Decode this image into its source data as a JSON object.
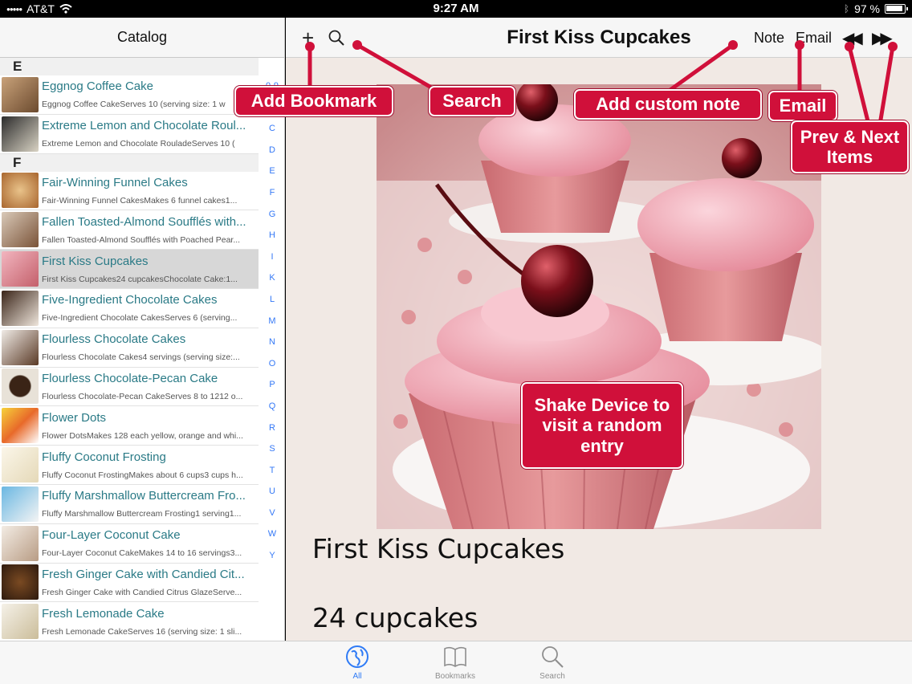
{
  "status": {
    "carrier": "AT&T",
    "time": "9:27 AM",
    "battery": "97 %"
  },
  "sidebar": {
    "title": "Catalog",
    "sections": [
      {
        "letter": "E",
        "items": [
          {
            "title": "Eggnog Coffee Cake",
            "subtitle": "Eggnog Coffee CakeServes 10 (serving size: 1 w"
          },
          {
            "title": "Extreme Lemon and Chocolate Roul...",
            "subtitle": "Extreme Lemon and Chocolate RouladeServes 10 ("
          }
        ]
      },
      {
        "letter": "F",
        "items": [
          {
            "title": "Fair-Winning Funnel Cakes",
            "subtitle": "Fair-Winning Funnel CakesMakes 6 funnel cakes1..."
          },
          {
            "title": "Fallen Toasted-Almond Soufflés with...",
            "subtitle": "Fallen Toasted-Almond Soufflés with Poached Pear..."
          },
          {
            "title": "First Kiss Cupcakes",
            "subtitle": "First Kiss Cupcakes24 cupcakesChocolate Cake:1..."
          },
          {
            "title": "Five-Ingredient Chocolate Cakes",
            "subtitle": "Five-Ingredient Chocolate CakesServes 6 (serving..."
          },
          {
            "title": "Flourless Chocolate Cakes",
            "subtitle": "Flourless Chocolate Cakes4 servings (serving size:..."
          },
          {
            "title": "Flourless Chocolate-Pecan Cake",
            "subtitle": "Flourless Chocolate-Pecan CakeServes 8 to 1212 o..."
          },
          {
            "title": "Flower Dots",
            "subtitle": "Flower DotsMakes 128 each yellow, orange and whi..."
          },
          {
            "title": "Fluffy Coconut Frosting",
            "subtitle": "Fluffy Coconut FrostingMakes about 6 cups3 cups h..."
          },
          {
            "title": "Fluffy Marshmallow Buttercream Fro...",
            "subtitle": "Fluffy Marshmallow Buttercream Frosting1 serving1..."
          },
          {
            "title": "Four-Layer Coconut Cake",
            "subtitle": "Four-Layer Coconut CakeMakes 14 to 16 servings3..."
          },
          {
            "title": "Fresh Ginger Cake with Candied Cit...",
            "subtitle": "Fresh Ginger Cake with Candied Citrus GlazeServe..."
          },
          {
            "title": "Fresh Lemonade Cake",
            "subtitle": "Fresh Lemonade CakeServes 16 (serving size: 1 sli..."
          }
        ]
      }
    ],
    "index": [
      "0-9",
      "B",
      "C",
      "D",
      "E",
      "F",
      "G",
      "H",
      "I",
      "K",
      "L",
      "M",
      "N",
      "O",
      "P",
      "Q",
      "R",
      "S",
      "T",
      "U",
      "V",
      "W",
      "Y"
    ]
  },
  "toolbar": {
    "title": "First Kiss Cupcakes",
    "note_label": "Note",
    "email_label": "Email",
    "prev_label": "◀◀",
    "next_label": "▶▶"
  },
  "recipe": {
    "title": "First Kiss Cupcakes",
    "yield": "24 cupcakes"
  },
  "tabs": [
    {
      "label": "All",
      "icon": "globe-icon"
    },
    {
      "label": "Bookmarks",
      "icon": "book-icon"
    },
    {
      "label": "Search",
      "icon": "search-icon"
    }
  ],
  "callouts": {
    "add_bookmark": "Add Bookmark",
    "search": "Search",
    "add_note": "Add custom note",
    "email": "Email",
    "prev_next": "Prev & Next Items",
    "shake": "Shake Device to visit a random entry"
  },
  "colors": {
    "accent": "#2f7bf6",
    "callout": "#d0103a",
    "item_title": "#2a7a86"
  }
}
